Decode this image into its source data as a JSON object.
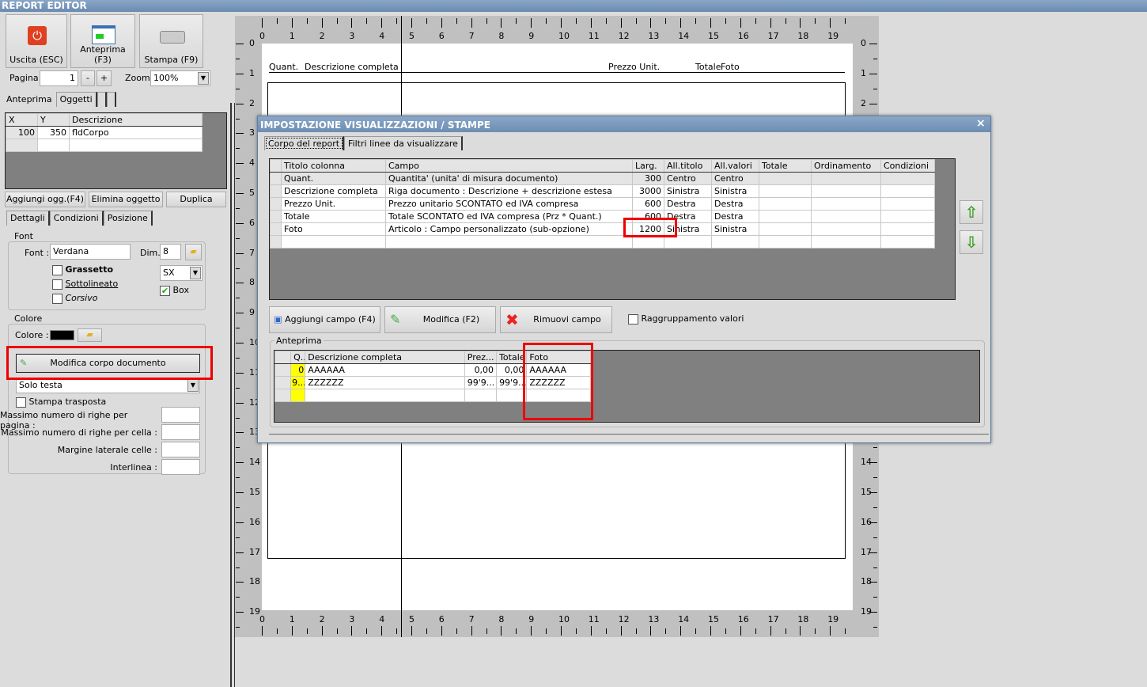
{
  "window": {
    "title": "REPORT EDITOR"
  },
  "toolbar": {
    "exit": "Uscita (ESC)",
    "preview": "Anteprima (F3)",
    "print": "Stampa (F9)",
    "page_label": "Pagina",
    "page_value": "1",
    "minus": "-",
    "plus": "+",
    "zoom_label": "Zoom",
    "zoom_value": "100%"
  },
  "left_tabs": [
    "Anteprima",
    "Oggetti",
    "",
    ""
  ],
  "objects_table": {
    "headers": [
      "X",
      "Y",
      "Descrizione"
    ],
    "rows": [
      [
        "100",
        "350",
        "fldCorpo"
      ]
    ]
  },
  "object_buttons": {
    "add": "Aggiungi ogg.(F4)",
    "delete": "Elimina oggetto",
    "duplicate": "Duplica"
  },
  "detail_tabs": [
    "Dettagli",
    "Condizioni",
    "Posizione"
  ],
  "font_group": {
    "title": "Font",
    "font_label": "Font :",
    "font_value": "Verdana",
    "dim_label": "Dim.",
    "dim_value": "8",
    "bold": "Grassetto",
    "underline": "Sottolineato",
    "italic": "Corsivo",
    "align_value": "SX",
    "box": "Box",
    "box_checked": true
  },
  "color_group": {
    "title": "Colore",
    "color_label": "Colore :",
    "color_value": "#000000"
  },
  "body_section": {
    "edit_button": "Modifica corpo documento",
    "mode_value": "Solo testa",
    "transposed": "Stampa trasposta",
    "max_rows_page": "Massimo numero di righe per pagina :",
    "max_rows_cell": "Massimo numero di righe per cella :",
    "margin": "Margine laterale celle :",
    "line_spacing": "Interlinea :"
  },
  "ruler": {
    "labels": [
      "0",
      "1",
      "2",
      "3",
      "4",
      "5",
      "6",
      "7",
      "8",
      "9",
      "10",
      "11",
      "12",
      "13",
      "14",
      "15",
      "16",
      "17",
      "18",
      "19"
    ]
  },
  "page_header": {
    "quant": "Quant.",
    "desc": "Descrizione completa",
    "price": "Prezzo Unit.",
    "total": "Totale",
    "photo": "Foto"
  },
  "dialog": {
    "title": "IMPOSTAZIONE VISUALIZZAZIONI / STAMPE",
    "close": "×",
    "tabs": [
      "Corpo del report",
      "Filtri linee da visualizzare"
    ],
    "columns_table": {
      "headers": [
        "Titolo colonna",
        "Campo",
        "Larg.",
        "All.titolo",
        "All.valori",
        "Totale",
        "Ordinamento",
        "Condizioni"
      ],
      "rows": [
        [
          "Quant.",
          "Quantita' (unita' di misura documento)",
          "300",
          "Centro",
          "Centro",
          "",
          "",
          ""
        ],
        [
          "Descrizione completa",
          "Riga documento : Descrizione + descrizione estesa",
          "3000",
          "Sinistra",
          "Sinistra",
          "",
          "",
          ""
        ],
        [
          "Prezzo Unit.",
          "Prezzo unitario SCONTATO ed IVA compresa",
          "600",
          "Destra",
          "Destra",
          "",
          "",
          ""
        ],
        [
          "Totale",
          "Totale SCONTATO ed IVA compresa (Prz * Quant.)",
          "600",
          "Destra",
          "Destra",
          "",
          "",
          ""
        ],
        [
          "Foto",
          "Articolo : Campo personalizzato (sub-opzione)",
          "1200",
          "Sinistra",
          "Sinistra",
          "",
          "",
          ""
        ]
      ]
    },
    "buttons": {
      "add": "Aggiungi campo (F4)",
      "edit": "Modifica (F2)",
      "remove": "Rimuovi campo",
      "grouping": "Raggruppamento valori"
    },
    "preview": {
      "title": "Anteprima",
      "headers": [
        "Q...",
        "Descrizione completa",
        "Prez...",
        "Totale",
        "Foto"
      ],
      "rows": [
        [
          "0",
          "AAAAAA",
          "0,00",
          "0,00",
          "AAAAAA"
        ],
        [
          "9...",
          "ZZZZZZ",
          "99'9...",
          "99'9...",
          "ZZZZZZ"
        ]
      ]
    }
  },
  "colors": {
    "accent_red": "#e00000",
    "title_blue": "#6a8bb2",
    "yellow": "#ffff00"
  }
}
